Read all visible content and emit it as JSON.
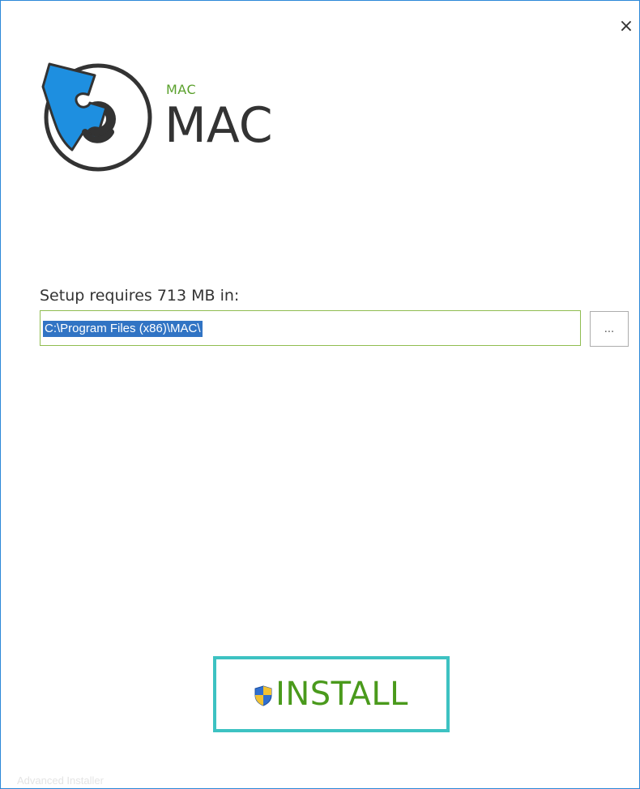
{
  "window": {
    "close_glyph": "×",
    "border_color": "#2b88d8"
  },
  "header": {
    "brand_small": "MAC",
    "brand_large": "MAC",
    "logo_icon": "puzzle-disc-icon",
    "accent_color": "#5aa02c",
    "logo_puzzle_color": "#1e8fe0"
  },
  "install_location": {
    "label": "Setup requires 713 MB in:",
    "path_value": "C:\\Program Files (x86)\\MAC\\",
    "browse_label": "..."
  },
  "actions": {
    "install_label": "INSTALL",
    "install_icon": "uac-shield-icon",
    "install_border_color": "#3dc2c2",
    "install_text_color": "#4a9a1c"
  },
  "footer": {
    "brand": "Advanced Installer"
  }
}
